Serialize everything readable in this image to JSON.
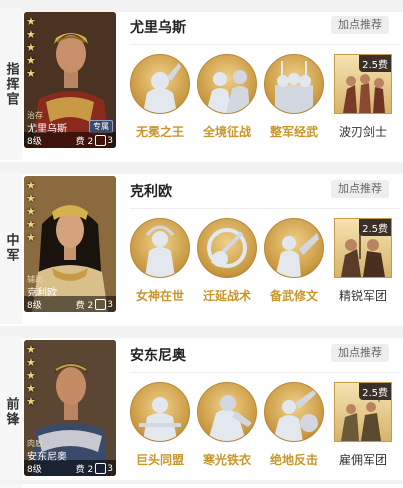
{
  "generals": [
    {
      "position": "指挥官",
      "stars": 5,
      "role": "治存",
      "card_name": "尤里乌斯",
      "tag": "专属",
      "level": "8级",
      "cost": "费 2",
      "troop_count": "3",
      "name": "尤里乌斯",
      "recommend": "加点推荐",
      "skills": [
        "无冕之王",
        "全境征战",
        "整军经武"
      ],
      "unit": {
        "cost": "2.5费",
        "name": "波刃剑士"
      }
    },
    {
      "position": "中军",
      "stars": 5,
      "role": "辅助",
      "card_name": "克利欧",
      "level": "8级",
      "cost": "费 2",
      "troop_count": "3",
      "name": "克利欧",
      "recommend": "加点推荐",
      "skills": [
        "女神在世",
        "迁延战术",
        "备武修文"
      ],
      "unit": {
        "cost": "2.5费",
        "name": "精锐军团"
      }
    },
    {
      "position": "前锋",
      "stars": 5,
      "role": "肉盾",
      "card_name": "安东尼奥",
      "level": "8级",
      "cost": "费 2",
      "troop_count": "3",
      "name": "安东尼奥",
      "recommend": "加点推荐",
      "skills": [
        "巨头同盟",
        "寒光铁衣",
        "绝地反击"
      ],
      "unit": {
        "cost": "2.5费",
        "name": "雇佣军团"
      }
    }
  ],
  "colors": {
    "skill_text": "#c8962a",
    "skill_circle": "#d4a24e",
    "cost_badge": "#3b3028",
    "star": "#f4d37c"
  }
}
